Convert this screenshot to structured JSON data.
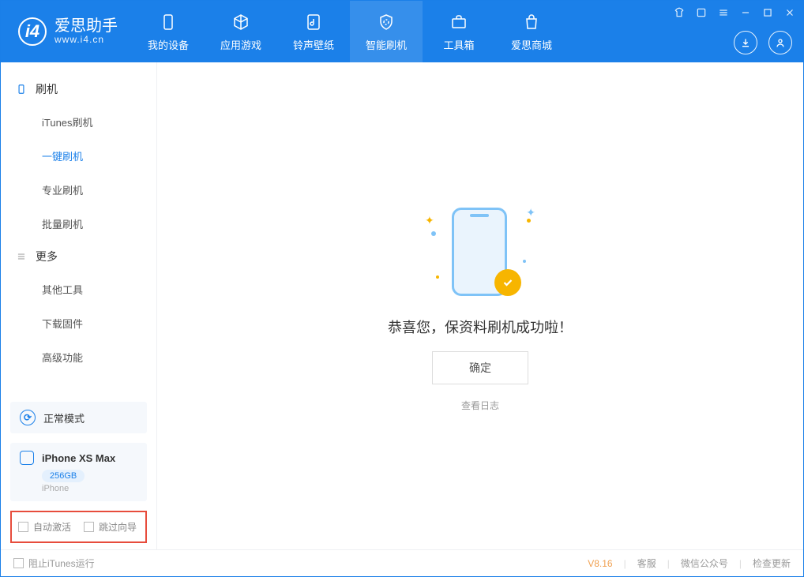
{
  "app": {
    "title": "爱思助手",
    "subtitle": "www.i4.cn"
  },
  "nav": {
    "items": [
      {
        "label": "我的设备"
      },
      {
        "label": "应用游戏"
      },
      {
        "label": "铃声壁纸"
      },
      {
        "label": "智能刷机"
      },
      {
        "label": "工具箱"
      },
      {
        "label": "爱思商城"
      }
    ]
  },
  "sidebar": {
    "group1": {
      "title": "刷机",
      "items": [
        "iTunes刷机",
        "一键刷机",
        "专业刷机",
        "批量刷机"
      ]
    },
    "group2": {
      "title": "更多",
      "items": [
        "其他工具",
        "下载固件",
        "高级功能"
      ]
    },
    "mode_card": "正常模式",
    "device": {
      "name": "iPhone XS Max",
      "capacity": "256GB",
      "type": "iPhone"
    },
    "checks": {
      "auto_activate": "自动激活",
      "skip_guide": "跳过向导"
    }
  },
  "main": {
    "success_msg": "恭喜您，保资料刷机成功啦！",
    "ok_btn": "确定",
    "log_link": "查看日志"
  },
  "footer": {
    "block_itunes": "阻止iTunes运行",
    "version": "V8.16",
    "links": [
      "客服",
      "微信公众号",
      "检查更新"
    ]
  }
}
